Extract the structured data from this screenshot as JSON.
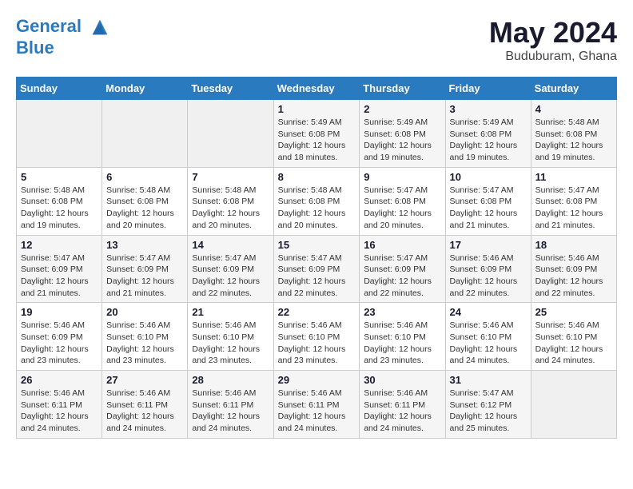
{
  "header": {
    "logo_line1": "General",
    "logo_line2": "Blue",
    "month_year": "May 2024",
    "location": "Buduburam, Ghana"
  },
  "weekdays": [
    "Sunday",
    "Monday",
    "Tuesday",
    "Wednesday",
    "Thursday",
    "Friday",
    "Saturday"
  ],
  "weeks": [
    [
      {
        "day": "",
        "info": ""
      },
      {
        "day": "",
        "info": ""
      },
      {
        "day": "",
        "info": ""
      },
      {
        "day": "1",
        "info": "Sunrise: 5:49 AM\nSunset: 6:08 PM\nDaylight: 12 hours\nand 18 minutes."
      },
      {
        "day": "2",
        "info": "Sunrise: 5:49 AM\nSunset: 6:08 PM\nDaylight: 12 hours\nand 19 minutes."
      },
      {
        "day": "3",
        "info": "Sunrise: 5:49 AM\nSunset: 6:08 PM\nDaylight: 12 hours\nand 19 minutes."
      },
      {
        "day": "4",
        "info": "Sunrise: 5:48 AM\nSunset: 6:08 PM\nDaylight: 12 hours\nand 19 minutes."
      }
    ],
    [
      {
        "day": "5",
        "info": "Sunrise: 5:48 AM\nSunset: 6:08 PM\nDaylight: 12 hours\nand 19 minutes."
      },
      {
        "day": "6",
        "info": "Sunrise: 5:48 AM\nSunset: 6:08 PM\nDaylight: 12 hours\nand 20 minutes."
      },
      {
        "day": "7",
        "info": "Sunrise: 5:48 AM\nSunset: 6:08 PM\nDaylight: 12 hours\nand 20 minutes."
      },
      {
        "day": "8",
        "info": "Sunrise: 5:48 AM\nSunset: 6:08 PM\nDaylight: 12 hours\nand 20 minutes."
      },
      {
        "day": "9",
        "info": "Sunrise: 5:47 AM\nSunset: 6:08 PM\nDaylight: 12 hours\nand 20 minutes."
      },
      {
        "day": "10",
        "info": "Sunrise: 5:47 AM\nSunset: 6:08 PM\nDaylight: 12 hours\nand 21 minutes."
      },
      {
        "day": "11",
        "info": "Sunrise: 5:47 AM\nSunset: 6:08 PM\nDaylight: 12 hours\nand 21 minutes."
      }
    ],
    [
      {
        "day": "12",
        "info": "Sunrise: 5:47 AM\nSunset: 6:09 PM\nDaylight: 12 hours\nand 21 minutes."
      },
      {
        "day": "13",
        "info": "Sunrise: 5:47 AM\nSunset: 6:09 PM\nDaylight: 12 hours\nand 21 minutes."
      },
      {
        "day": "14",
        "info": "Sunrise: 5:47 AM\nSunset: 6:09 PM\nDaylight: 12 hours\nand 22 minutes."
      },
      {
        "day": "15",
        "info": "Sunrise: 5:47 AM\nSunset: 6:09 PM\nDaylight: 12 hours\nand 22 minutes."
      },
      {
        "day": "16",
        "info": "Sunrise: 5:47 AM\nSunset: 6:09 PM\nDaylight: 12 hours\nand 22 minutes."
      },
      {
        "day": "17",
        "info": "Sunrise: 5:46 AM\nSunset: 6:09 PM\nDaylight: 12 hours\nand 22 minutes."
      },
      {
        "day": "18",
        "info": "Sunrise: 5:46 AM\nSunset: 6:09 PM\nDaylight: 12 hours\nand 22 minutes."
      }
    ],
    [
      {
        "day": "19",
        "info": "Sunrise: 5:46 AM\nSunset: 6:09 PM\nDaylight: 12 hours\nand 23 minutes."
      },
      {
        "day": "20",
        "info": "Sunrise: 5:46 AM\nSunset: 6:10 PM\nDaylight: 12 hours\nand 23 minutes."
      },
      {
        "day": "21",
        "info": "Sunrise: 5:46 AM\nSunset: 6:10 PM\nDaylight: 12 hours\nand 23 minutes."
      },
      {
        "day": "22",
        "info": "Sunrise: 5:46 AM\nSunset: 6:10 PM\nDaylight: 12 hours\nand 23 minutes."
      },
      {
        "day": "23",
        "info": "Sunrise: 5:46 AM\nSunset: 6:10 PM\nDaylight: 12 hours\nand 23 minutes."
      },
      {
        "day": "24",
        "info": "Sunrise: 5:46 AM\nSunset: 6:10 PM\nDaylight: 12 hours\nand 24 minutes."
      },
      {
        "day": "25",
        "info": "Sunrise: 5:46 AM\nSunset: 6:10 PM\nDaylight: 12 hours\nand 24 minutes."
      }
    ],
    [
      {
        "day": "26",
        "info": "Sunrise: 5:46 AM\nSunset: 6:11 PM\nDaylight: 12 hours\nand 24 minutes."
      },
      {
        "day": "27",
        "info": "Sunrise: 5:46 AM\nSunset: 6:11 PM\nDaylight: 12 hours\nand 24 minutes."
      },
      {
        "day": "28",
        "info": "Sunrise: 5:46 AM\nSunset: 6:11 PM\nDaylight: 12 hours\nand 24 minutes."
      },
      {
        "day": "29",
        "info": "Sunrise: 5:46 AM\nSunset: 6:11 PM\nDaylight: 12 hours\nand 24 minutes."
      },
      {
        "day": "30",
        "info": "Sunrise: 5:46 AM\nSunset: 6:11 PM\nDaylight: 12 hours\nand 24 minutes."
      },
      {
        "day": "31",
        "info": "Sunrise: 5:47 AM\nSunset: 6:12 PM\nDaylight: 12 hours\nand 25 minutes."
      },
      {
        "day": "",
        "info": ""
      }
    ]
  ]
}
